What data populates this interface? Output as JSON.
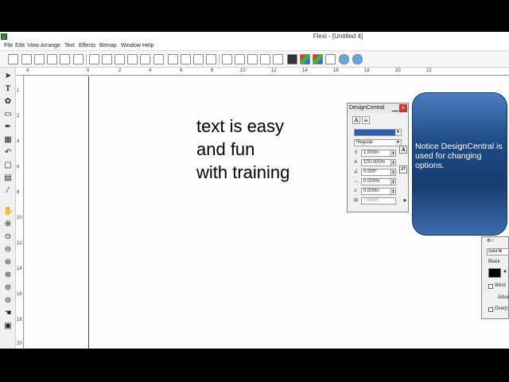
{
  "window": {
    "title": "Flexi - [Untitled 4]"
  },
  "menu": [
    "File",
    "Edit",
    "View",
    "Arrange",
    "Text",
    "Effects",
    "Bitmap",
    "Window",
    "Help"
  ],
  "toolbar": {
    "buttons": [
      "new-icon",
      "open-icon",
      "save-icon",
      "save-all-icon",
      "print-icon",
      "cut-icon",
      "copy-icon",
      "paste-icon",
      "undo-icon",
      "redo-icon",
      "undo-arrow-icon",
      "redo-arrow-icon",
      "align-icon",
      "group-icon",
      "ungroup-icon",
      "combine-icon",
      "zoom-icon",
      "fill-icon",
      "color-fill-icon",
      "color-picker-icon",
      "outline-icon",
      "cloud-icon",
      "cloud-upload-icon"
    ]
  },
  "toolbox": [
    "pointer-icon",
    "text-icon",
    "shape-icon",
    "rectangle-icon",
    "pen-icon",
    "node-icon",
    "curve-icon",
    "crop-icon",
    "bitmap-icon",
    "eyedropper-icon",
    "pan-icon",
    "zoom-in-icon",
    "zoom-page-icon",
    "zoom-out-icon",
    "zoom-selection-icon",
    "zoom-all-icon",
    "zoom-fit-icon",
    "zoom-world-icon",
    "hand-icon",
    "print-icon"
  ],
  "ruler": {
    "h_ticks": [
      "4",
      "0",
      "2",
      "4",
      "6",
      "8",
      "10",
      "12",
      "14",
      "16",
      "18",
      "20",
      "22"
    ],
    "v_ticks": [
      "1",
      "2",
      "4",
      "6",
      "8",
      "10",
      "12",
      "14",
      "16",
      "18",
      "20"
    ]
  },
  "canvas": {
    "text": "text is easy\nand fun\nwith training"
  },
  "designcentral": {
    "title": "DesignCentral",
    "tabs": [
      "A",
      "≡"
    ],
    "font_name": "",
    "font_style": "Regular",
    "size": "1.000in",
    "width_pct": "100.000%",
    "slant": "0.000°",
    "spacing_pct": "0.000%",
    "offset": "0.000in",
    "last": "T34Bm"
  },
  "callout": {
    "text": "Notice DesignCentral is used for changing options."
  },
  "fill_panel": {
    "field": "Solid fill",
    "color_label": "Black",
    "check1": "Wind",
    "button": "Adva",
    "check2": "Overp"
  },
  "colors": {
    "callout_fill": "#1e4b86",
    "selection": "#2b5fb3"
  }
}
